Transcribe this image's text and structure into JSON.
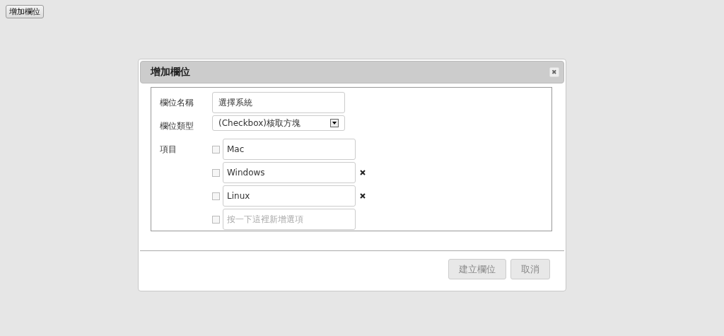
{
  "top_button": "增加欄位",
  "dialog": {
    "title": "增加欄位",
    "close": "✖",
    "fields": [
      {
        "kind": "text",
        "label": "欄位名稱",
        "value": "選擇系統"
      },
      {
        "kind": "select",
        "label": "欄位類型",
        "value": "(Checkbox)核取方塊"
      }
    ],
    "items_label": "項目",
    "items": [
      {
        "kind": "option",
        "value": "Mac",
        "checked": false,
        "removable": false
      },
      {
        "kind": "option",
        "value": "Windows",
        "checked": false,
        "removable": true
      },
      {
        "kind": "option",
        "value": "Linux",
        "checked": false,
        "removable": true
      },
      {
        "kind": "new",
        "placeholder": "按一下這裡新增選項",
        "checked": false,
        "removable": false
      }
    ],
    "buttons": [
      {
        "label": "建立欄位"
      },
      {
        "label": "取消"
      }
    ]
  }
}
